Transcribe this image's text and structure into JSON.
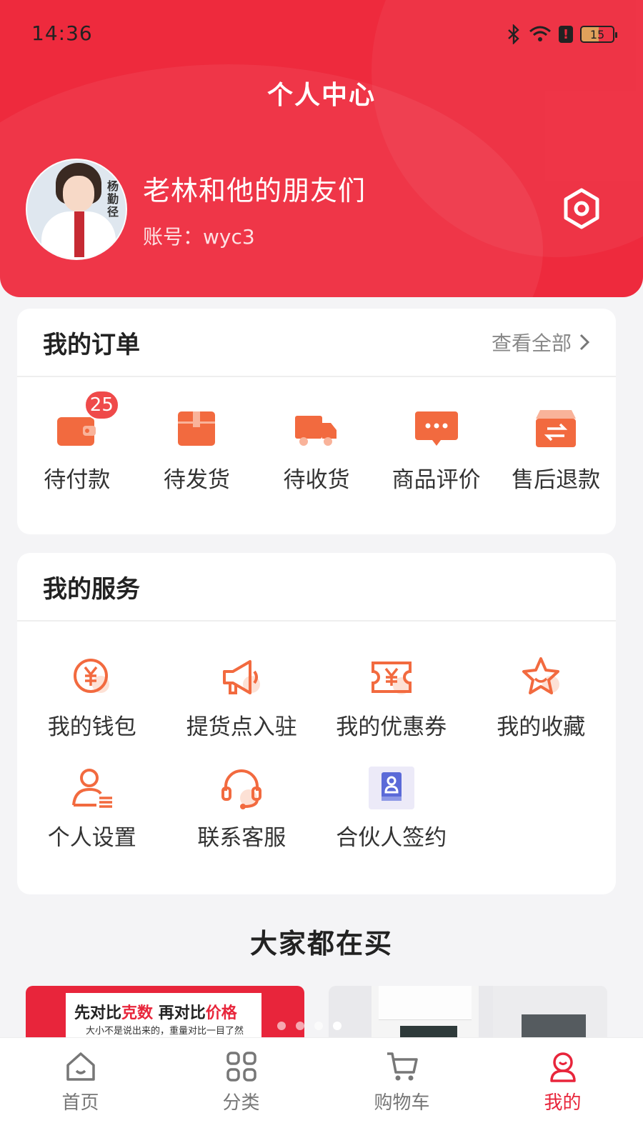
{
  "status_bar": {
    "time": "14:36",
    "battery": "15"
  },
  "header": {
    "title": "个人中心",
    "username": "老林和他的朋友们",
    "account": "账号：wyc3",
    "avatar_text": "杨勤径"
  },
  "orders": {
    "title": "我的订单",
    "view_all": "查看全部",
    "items": [
      {
        "label": "待付款",
        "badge": "25",
        "icon": "wallet-icon"
      },
      {
        "label": "待发货",
        "icon": "package-icon"
      },
      {
        "label": "待收货",
        "icon": "truck-icon"
      },
      {
        "label": "商品评价",
        "icon": "comment-icon"
      },
      {
        "label": "售后退款",
        "icon": "refund-icon"
      }
    ]
  },
  "services": {
    "title": "我的服务",
    "items": [
      {
        "label": "我的钱包",
        "icon": "yuan-coin-icon"
      },
      {
        "label": "提货点入驻",
        "icon": "megaphone-icon"
      },
      {
        "label": "我的优惠券",
        "icon": "coupon-icon"
      },
      {
        "label": "我的收藏",
        "icon": "star-icon"
      },
      {
        "label": "个人设置",
        "icon": "user-settings-icon"
      },
      {
        "label": "联系客服",
        "icon": "headset-icon"
      },
      {
        "label": "合伙人签约",
        "icon": "contract-book-icon"
      }
    ]
  },
  "recommend": {
    "title": "大家都在买",
    "promo_prefix": "先对比",
    "promo_hl1": "克数",
    "promo_mid": " 再对比",
    "promo_hl2": "价格",
    "promo_sub": "大小不是说出来的，重量对比一目了然"
  },
  "tabbar": {
    "items": [
      {
        "label": "首页",
        "icon": "home-icon"
      },
      {
        "label": "分类",
        "icon": "category-grid-icon"
      },
      {
        "label": "购物车",
        "icon": "cart-icon"
      },
      {
        "label": "我的",
        "icon": "profile-icon",
        "active": true
      }
    ]
  },
  "colors": {
    "brand": "#ee2a3d",
    "icon_orange": "#f26a3f",
    "page_bg": "#f4f4f6"
  }
}
